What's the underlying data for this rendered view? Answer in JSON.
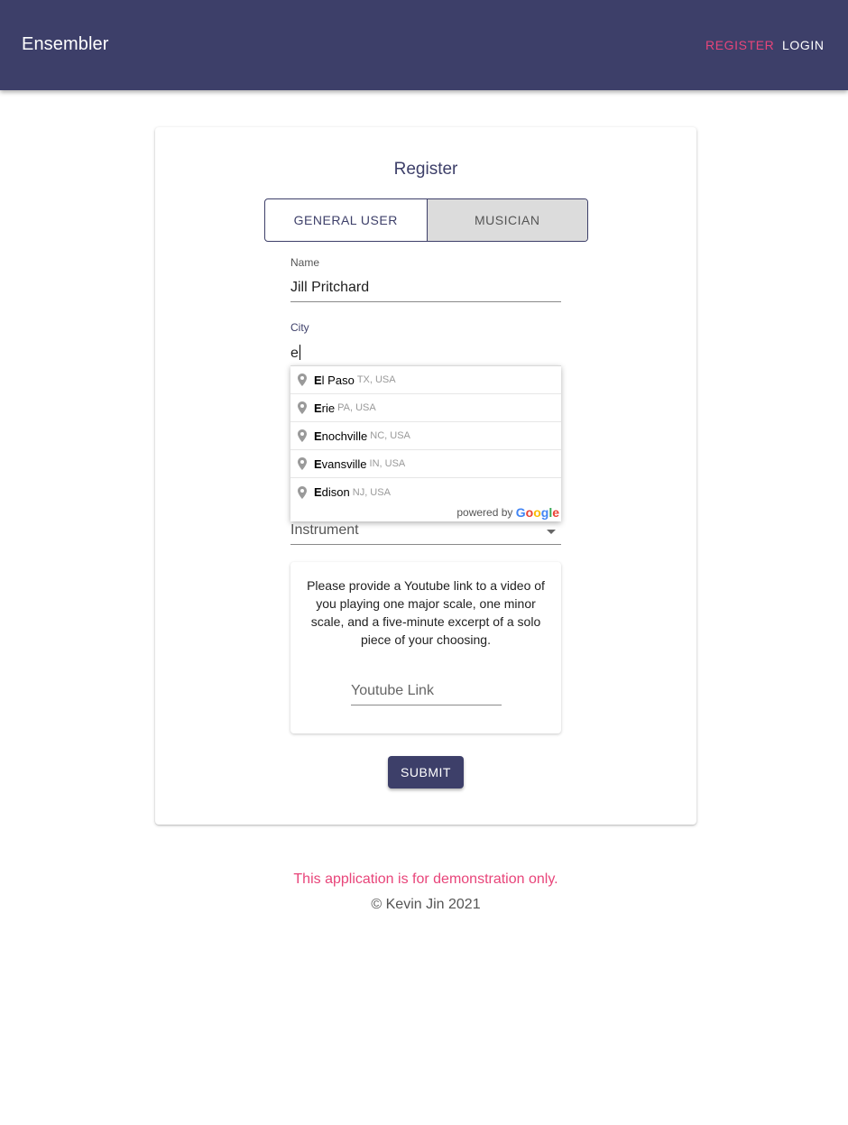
{
  "header": {
    "brand": "Ensembler",
    "nav": {
      "register": "REGISTER",
      "login": "LOGIN"
    },
    "accent_color": "#e8457a",
    "bar_color": "#3d3f69"
  },
  "form": {
    "title": "Register",
    "toggle": {
      "general": "GENERAL USER",
      "musician": "MUSICIAN"
    },
    "name": {
      "label": "Name",
      "value": "Jill Pritchard"
    },
    "city": {
      "label": "City",
      "value": "e"
    },
    "suggestions": [
      {
        "match": "E",
        "rest": "l Paso",
        "region": "TX, USA"
      },
      {
        "match": "E",
        "rest": "rie",
        "region": "PA, USA"
      },
      {
        "match": "E",
        "rest": "nochville",
        "region": "NC, USA"
      },
      {
        "match": "E",
        "rest": "vansville",
        "region": "IN, USA"
      },
      {
        "match": "E",
        "rest": "dison",
        "region": "NJ, USA"
      }
    ],
    "powered_by": "powered by",
    "google": {
      "G": "G",
      "o1": "o",
      "o2": "o",
      "g": "g",
      "l": "l",
      "e": "e"
    },
    "instrument": {
      "placeholder": "Instrument"
    },
    "video_instructions": "Please provide a Youtube link to a video of you playing one major scale, one minor scale, and a five-minute excerpt of a solo piece of your choosing.",
    "youtube": {
      "placeholder": "Youtube Link"
    },
    "submit": "SUBMIT"
  },
  "footer": {
    "note": "This application is for demonstration only.",
    "copyright": "© Kevin Jin 2021"
  }
}
